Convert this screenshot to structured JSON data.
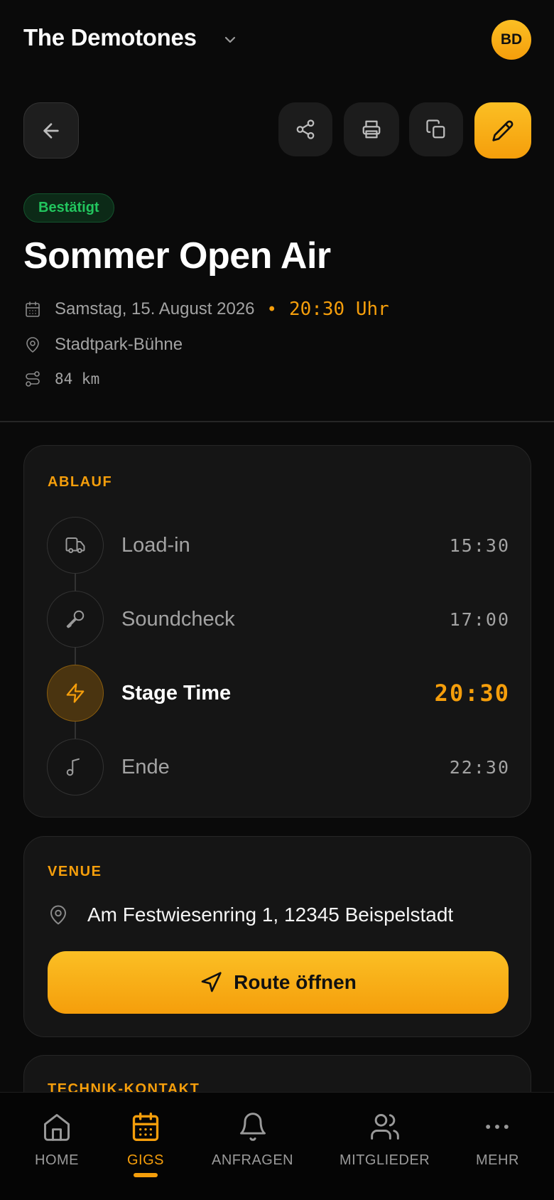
{
  "header": {
    "band_name": "The Demotones",
    "avatar_initials": "BD"
  },
  "gig": {
    "status": "Bestätigt",
    "title": "Sommer Open Air",
    "date": "Samstag, 15. August 2026",
    "time": "20:30 Uhr",
    "location": "Stadtpark-Bühne",
    "distance": "84 km"
  },
  "ablauf": {
    "label": "ABLAUF",
    "items": [
      {
        "label": "Load-in",
        "time": "15:30",
        "icon": "truck-icon",
        "active": false
      },
      {
        "label": "Soundcheck",
        "time": "17:00",
        "icon": "microphone-icon",
        "active": false
      },
      {
        "label": "Stage Time",
        "time": "20:30",
        "icon": "lightning-icon",
        "active": true
      },
      {
        "label": "Ende",
        "time": "22:30",
        "icon": "music-note-icon",
        "active": false
      }
    ]
  },
  "venue": {
    "label": "VENUE",
    "address": "Am Festwiesenring 1, 12345 Beispelstadt",
    "route_button": "Route öffnen"
  },
  "tech": {
    "label": "TECHNIK-KONTAKT"
  },
  "nav": {
    "items": [
      {
        "label": "HOME",
        "icon": "home-icon",
        "active": false
      },
      {
        "label": "GIGS",
        "icon": "calendar-icon",
        "active": true
      },
      {
        "label": "ANFRAGEN",
        "icon": "bell-icon",
        "active": false
      },
      {
        "label": "MITGLIEDER",
        "icon": "users-icon",
        "active": false
      },
      {
        "label": "MEHR",
        "icon": "more-icon",
        "active": false
      }
    ]
  },
  "colors": {
    "accent": "#f59e0b",
    "status_green": "#22c55e",
    "background": "#0a0a0a",
    "card": "#151515"
  }
}
